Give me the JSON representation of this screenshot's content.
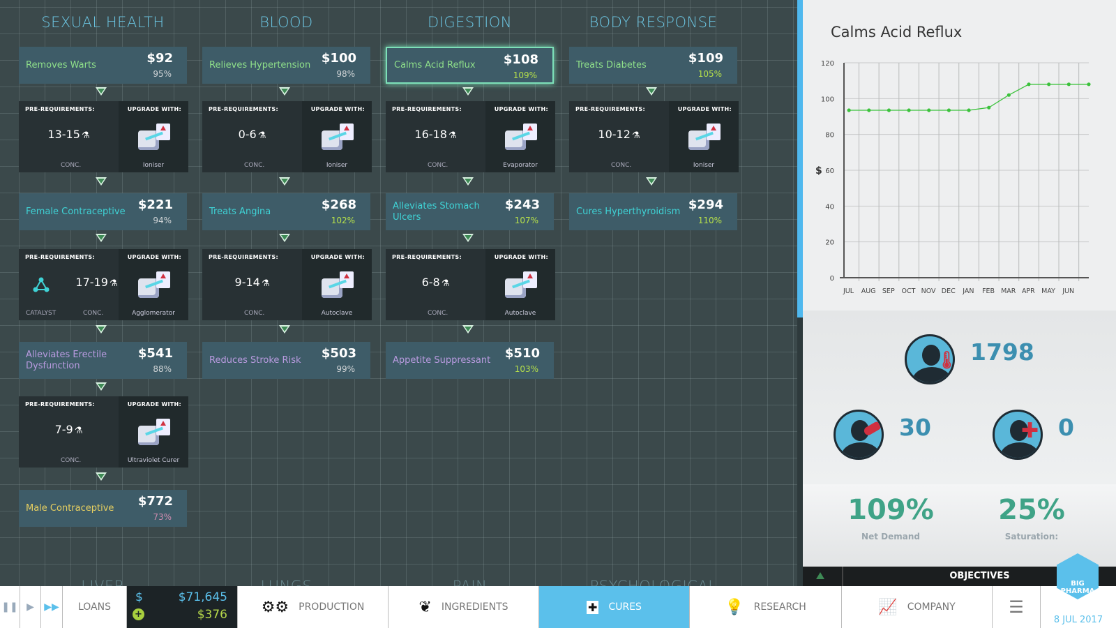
{
  "sections": [
    {
      "title": "SEXUAL HEALTH",
      "chain": [
        {
          "type": "cure",
          "name": "Removes Warts",
          "price": "$92",
          "percent": "95%",
          "tier": 1
        },
        {
          "type": "req",
          "value": "13-15",
          "catalyst": false,
          "machine": "Ioniser"
        },
        {
          "type": "cure",
          "name": "Female Contraceptive",
          "price": "$221",
          "percent": "94%",
          "tier": 2
        },
        {
          "type": "req",
          "value": "17-19",
          "catalyst": true,
          "machine": "Agglomerator"
        },
        {
          "type": "cure",
          "name": "Alleviates Erectile Dysfunction",
          "price": "$541",
          "percent": "88%",
          "tier": 3
        },
        {
          "type": "req",
          "value": "7-9",
          "catalyst": false,
          "machine": "Ultraviolet Curer"
        },
        {
          "type": "cure",
          "name": "Male Contraceptive",
          "price": "$772",
          "percent": "73%",
          "tier": 4
        }
      ]
    },
    {
      "title": "BLOOD",
      "chain": [
        {
          "type": "cure",
          "name": "Relieves Hypertension",
          "price": "$100",
          "percent": "98%",
          "tier": 1
        },
        {
          "type": "req",
          "value": "0-6",
          "catalyst": false,
          "machine": "Ioniser"
        },
        {
          "type": "cure",
          "name": "Treats Angina",
          "price": "$268",
          "percent": "102%",
          "tier": 2
        },
        {
          "type": "req",
          "value": "9-14",
          "catalyst": false,
          "machine": "Autoclave"
        },
        {
          "type": "cure",
          "name": "Reduces Stroke Risk",
          "price": "$503",
          "percent": "99%",
          "tier": 3
        }
      ]
    },
    {
      "title": "DIGESTION",
      "chain": [
        {
          "type": "cure",
          "name": "Calms Acid Reflux",
          "price": "$108",
          "percent": "109%",
          "tier": 1,
          "selected": true
        },
        {
          "type": "req",
          "value": "16-18",
          "catalyst": false,
          "machine": "Evaporator"
        },
        {
          "type": "cure",
          "name": "Alleviates Stomach Ulcers",
          "price": "$243",
          "percent": "107%",
          "tier": 2
        },
        {
          "type": "req",
          "value": "6-8",
          "catalyst": false,
          "machine": "Autoclave"
        },
        {
          "type": "cure",
          "name": "Appetite Suppressant",
          "price": "$510",
          "percent": "103%",
          "tier": 3
        }
      ]
    },
    {
      "title": "BODY RESPONSE",
      "chain": [
        {
          "type": "cure",
          "name": "Treats Diabetes",
          "price": "$109",
          "percent": "105%",
          "tier": 1
        },
        {
          "type": "req",
          "value": "10-12",
          "catalyst": false,
          "machine": "Ioniser"
        },
        {
          "type": "cure",
          "name": "Cures Hyperthyroidism",
          "price": "$294",
          "percent": "110%",
          "tier": 2
        }
      ]
    }
  ],
  "bottom_sections": [
    "LIVER",
    "LUNGS",
    "PAIN",
    "PSYCHOLOGICAL"
  ],
  "labels": {
    "pre": "PRE-REQUIREMENTS:",
    "upgrade": "UPGRADE WITH:",
    "conc": "CONC.",
    "catalyst": "CATALYST"
  },
  "colors": {
    "tier1": "#8fe08a",
    "tier2": "#3fd3d6",
    "tier3": "#b99be0",
    "tier4": "#e8d060",
    "pct_high": "#b6e04a",
    "pct_normal": "#d0d4d6",
    "pct_low": "#d08cb0",
    "accent": "#5bc0eb"
  },
  "panel": {
    "title": "Calms Acid Reflux",
    "patients": "1798",
    "pill": "30",
    "cured": "0",
    "net_demand": "109%",
    "net_demand_label": "Net Demand",
    "saturation": "25%",
    "saturation_label": "Saturation:"
  },
  "chart_data": {
    "type": "line",
    "title": "Calms Acid Reflux",
    "ylabel": "$",
    "xlabel": "",
    "ylim": [
      0,
      120
    ],
    "yticks": [
      0,
      20,
      40,
      60,
      80,
      100,
      120
    ],
    "categories": [
      "JUL",
      "AUG",
      "SEP",
      "OCT",
      "NOV",
      "DEC",
      "JAN",
      "FEB",
      "MAR",
      "APR",
      "MAY",
      "JUN"
    ],
    "values": [
      93.5,
      93.5,
      93.5,
      93.5,
      93.5,
      93.5,
      93.5,
      95,
      102,
      108,
      108,
      108,
      108
    ],
    "grid": true,
    "color": "#3cc23c"
  },
  "objectives": "OBJECTIVES",
  "bottom_bar": {
    "loans": "LOANS",
    "cash": "$71,645",
    "income": "$376",
    "production": "PRODUCTION",
    "ingredients": "INGREDIENTS",
    "cures": "CURES",
    "research": "RESEARCH",
    "company": "COMPANY",
    "date": "8 JUL 2017",
    "logo": "BIG PHARMA"
  }
}
